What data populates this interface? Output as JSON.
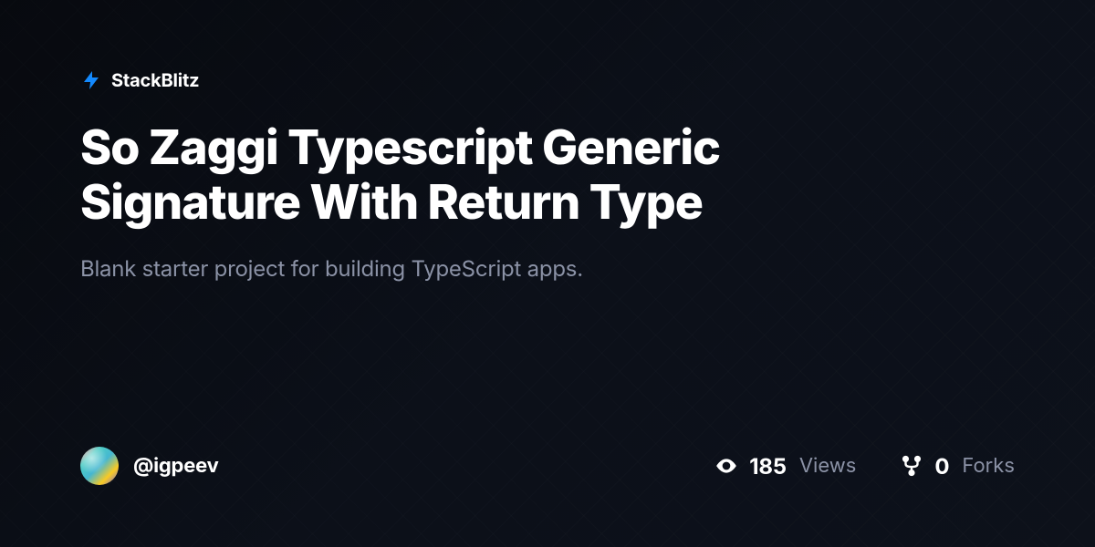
{
  "brand": {
    "name": "StackBlitz"
  },
  "project": {
    "title": "So Zaggi Typescript Generic Signature With Return Type",
    "description": "Blank starter project for building TypeScript apps."
  },
  "author": {
    "username": "@igpeev"
  },
  "stats": {
    "views": {
      "value": "185",
      "label": "Views"
    },
    "forks": {
      "value": "0",
      "label": "Forks"
    }
  },
  "colors": {
    "accent": "#1389fd",
    "background": "#0c1019",
    "text_primary": "#ffffff",
    "text_secondary": "#8b92a6"
  }
}
